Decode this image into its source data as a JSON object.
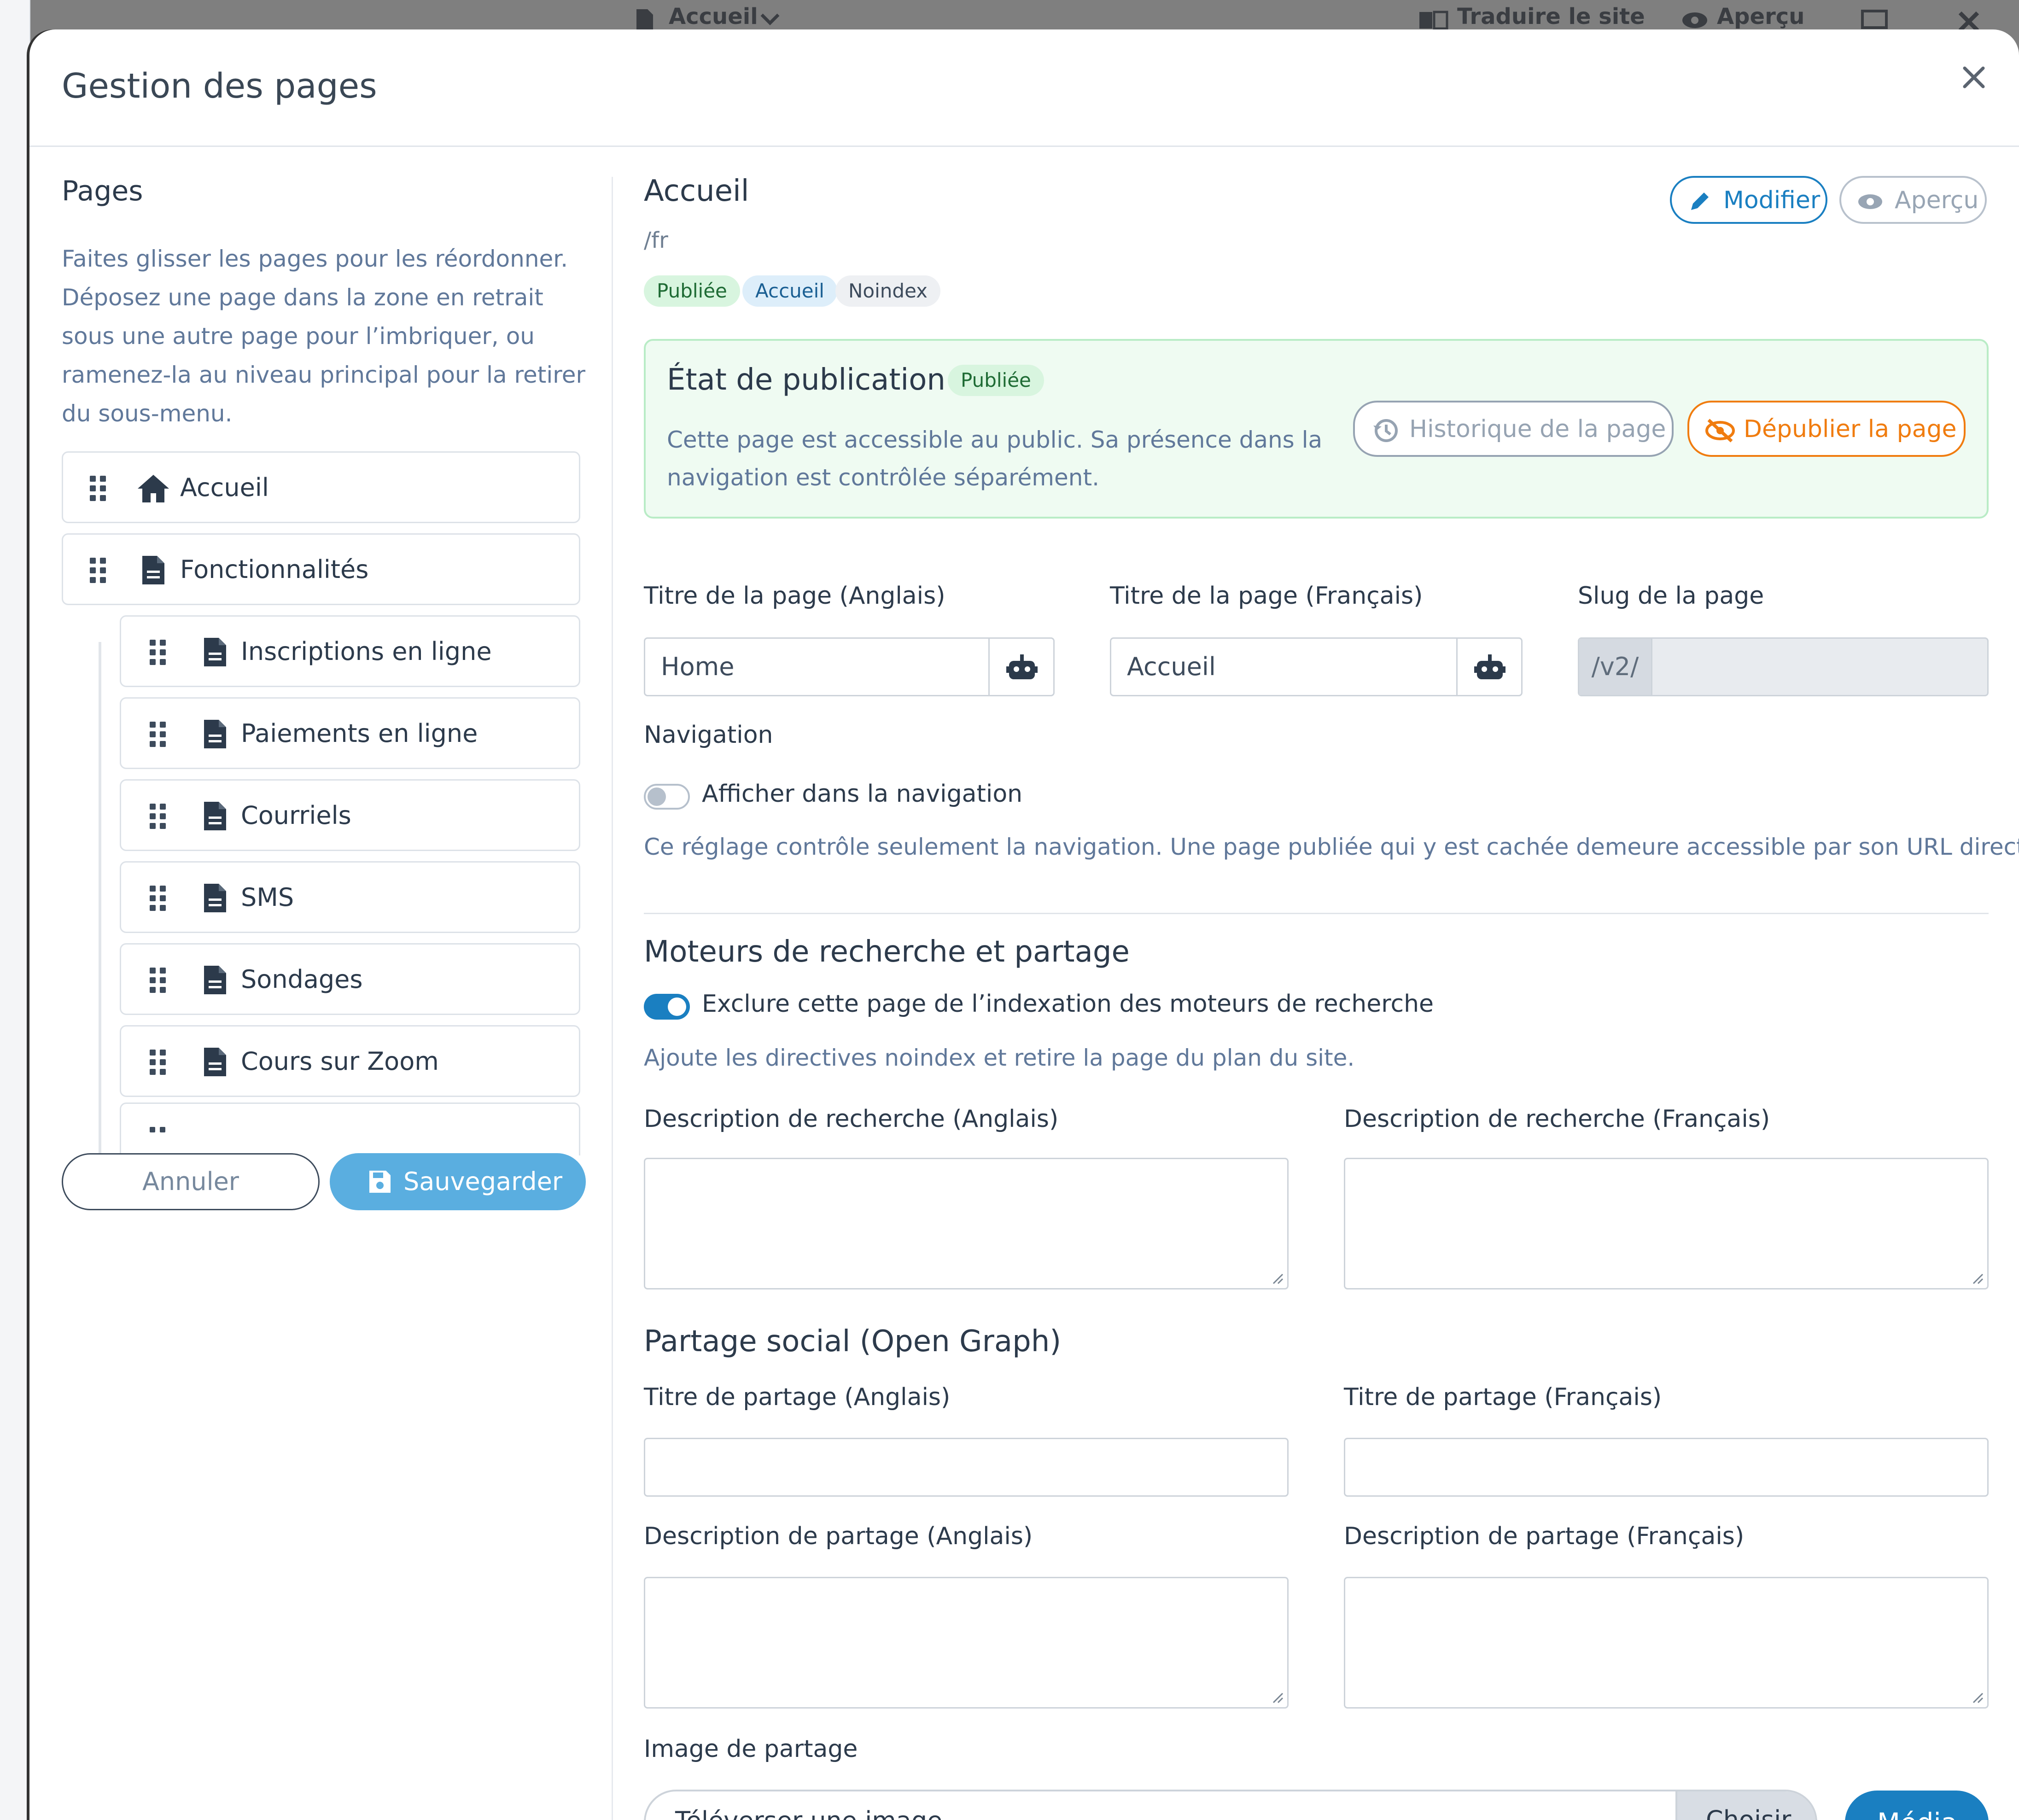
{
  "background": {
    "tab_label": "Accueil",
    "translate_label": "Traduire le site",
    "preview_label": "Aperçu"
  },
  "modal": {
    "title": "Gestion des pages"
  },
  "pages_panel": {
    "heading": "Pages",
    "help": "Faites glisser les pages pour les réordonner. Déposez une page dans la zone en retrait sous une autre page pour l’imbriquer, ou ramenez-la au niveau principal pour la retirer du sous-menu.",
    "items": [
      {
        "label": "Accueil",
        "icon": "home-icon",
        "level": 0
      },
      {
        "label": "Fonctionnalités",
        "icon": "file-icon",
        "level": 0
      },
      {
        "label": "Inscriptions en ligne",
        "icon": "file-icon",
        "level": 1
      },
      {
        "label": "Paiements en ligne",
        "icon": "file-icon",
        "level": 1
      },
      {
        "label": "Courriels",
        "icon": "file-icon",
        "level": 1
      },
      {
        "label": "SMS",
        "icon": "file-icon",
        "level": 1
      },
      {
        "label": "Sondages",
        "icon": "file-icon",
        "level": 1
      },
      {
        "label": "Cours sur Zoom",
        "icon": "file-icon",
        "level": 1
      }
    ],
    "cancel_label": "Annuler",
    "save_label": "Sauvegarder"
  },
  "detail": {
    "title": "Accueil",
    "path": "/fr",
    "badges": [
      "Publiée",
      "Accueil",
      "Noindex"
    ],
    "edit_label": "Modifier",
    "preview_label": "Aperçu",
    "publication": {
      "title": "État de publication",
      "badge": "Publiée",
      "description": "Cette page est accessible au public. Sa présence dans la navigation est contrôlée séparément.",
      "history_label": "Historique de la page",
      "unpublish_label": "Dépublier la page"
    },
    "fields": {
      "title_en_label": "Titre de la page (Anglais)",
      "title_en_value": "Home",
      "title_fr_label": "Titre de la page (Français)",
      "title_fr_value": "Accueil",
      "slug_label": "Slug de la page",
      "slug_prefix": "/v2/",
      "slug_value": ""
    },
    "navigation": {
      "heading": "Navigation",
      "toggle_label": "Afficher dans la navigation",
      "toggle_on": false,
      "help": "Ce réglage contrôle seulement la navigation. Une page publiée qui y est cachée demeure accessible par son URL directe."
    },
    "seo": {
      "heading": "Moteurs de recherche et partage",
      "noindex_label": "Exclure cette page de l’indexation des moteurs de recherche",
      "noindex_on": true,
      "noindex_help": "Ajoute les directives noindex et retire la page du plan du site.",
      "desc_en_label": "Description de recherche (Anglais)",
      "desc_fr_label": "Description de recherche (Français)"
    },
    "social": {
      "heading": "Partage social (Open Graph)",
      "title_en_label": "Titre de partage (Anglais)",
      "title_fr_label": "Titre de partage (Français)",
      "desc_en_label": "Description de partage (Anglais)",
      "desc_fr_label": "Description de partage (Français)",
      "image_label": "Image de partage",
      "upload_placeholder": "Téléverser une image",
      "choose_label": "Choisir",
      "media_label": "Média"
    }
  },
  "colors": {
    "primary": "#1a7fc1",
    "save": "#5aaee0",
    "orange": "#f07c0f",
    "published_bg": "#effbf2",
    "published_border": "#b9ecc6"
  }
}
